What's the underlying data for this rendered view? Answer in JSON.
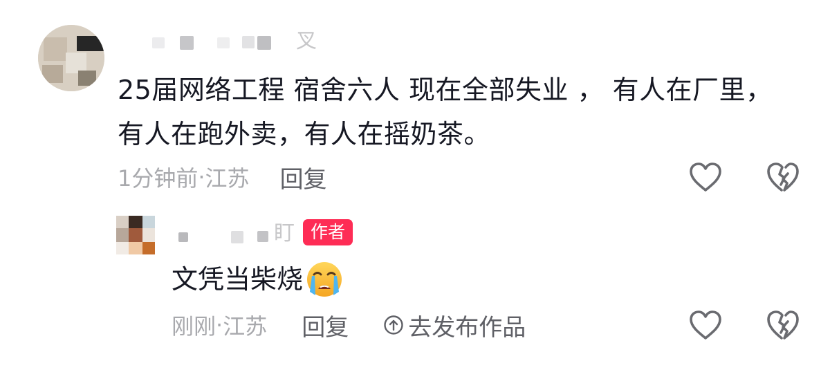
{
  "comments": [
    {
      "username_tail": "叉",
      "text_lines": [
        "25届网络工程 宿舍六人 现在全部失业 ， 有人在厂里，",
        "有人在跑外卖，有人在摇奶茶。"
      ],
      "time": "1分钟前",
      "location": "江苏",
      "meta_separator": " · ",
      "reply_label": "回复",
      "like_icon": "heart-outline-icon",
      "dislike_icon": "broken-heart-icon"
    }
  ],
  "reply": {
    "username_tail": "盯",
    "author_badge": "作者",
    "text": "文凭当柴烧",
    "emoji": "loudly-crying-face-emoji",
    "time": "刚刚",
    "location": "江苏",
    "meta_separator": " · ",
    "reply_label": "回复",
    "publish_label": "去发布作品",
    "publish_icon": "arrow-up-circle-icon",
    "like_icon": "heart-outline-icon",
    "dislike_icon": "broken-heart-icon"
  },
  "colors": {
    "text_primary": "#161823",
    "text_meta": "#a8a9ad",
    "text_action": "#5f6066",
    "badge_bg": "#fe2c55",
    "icon_stroke": "#6a6b70"
  }
}
